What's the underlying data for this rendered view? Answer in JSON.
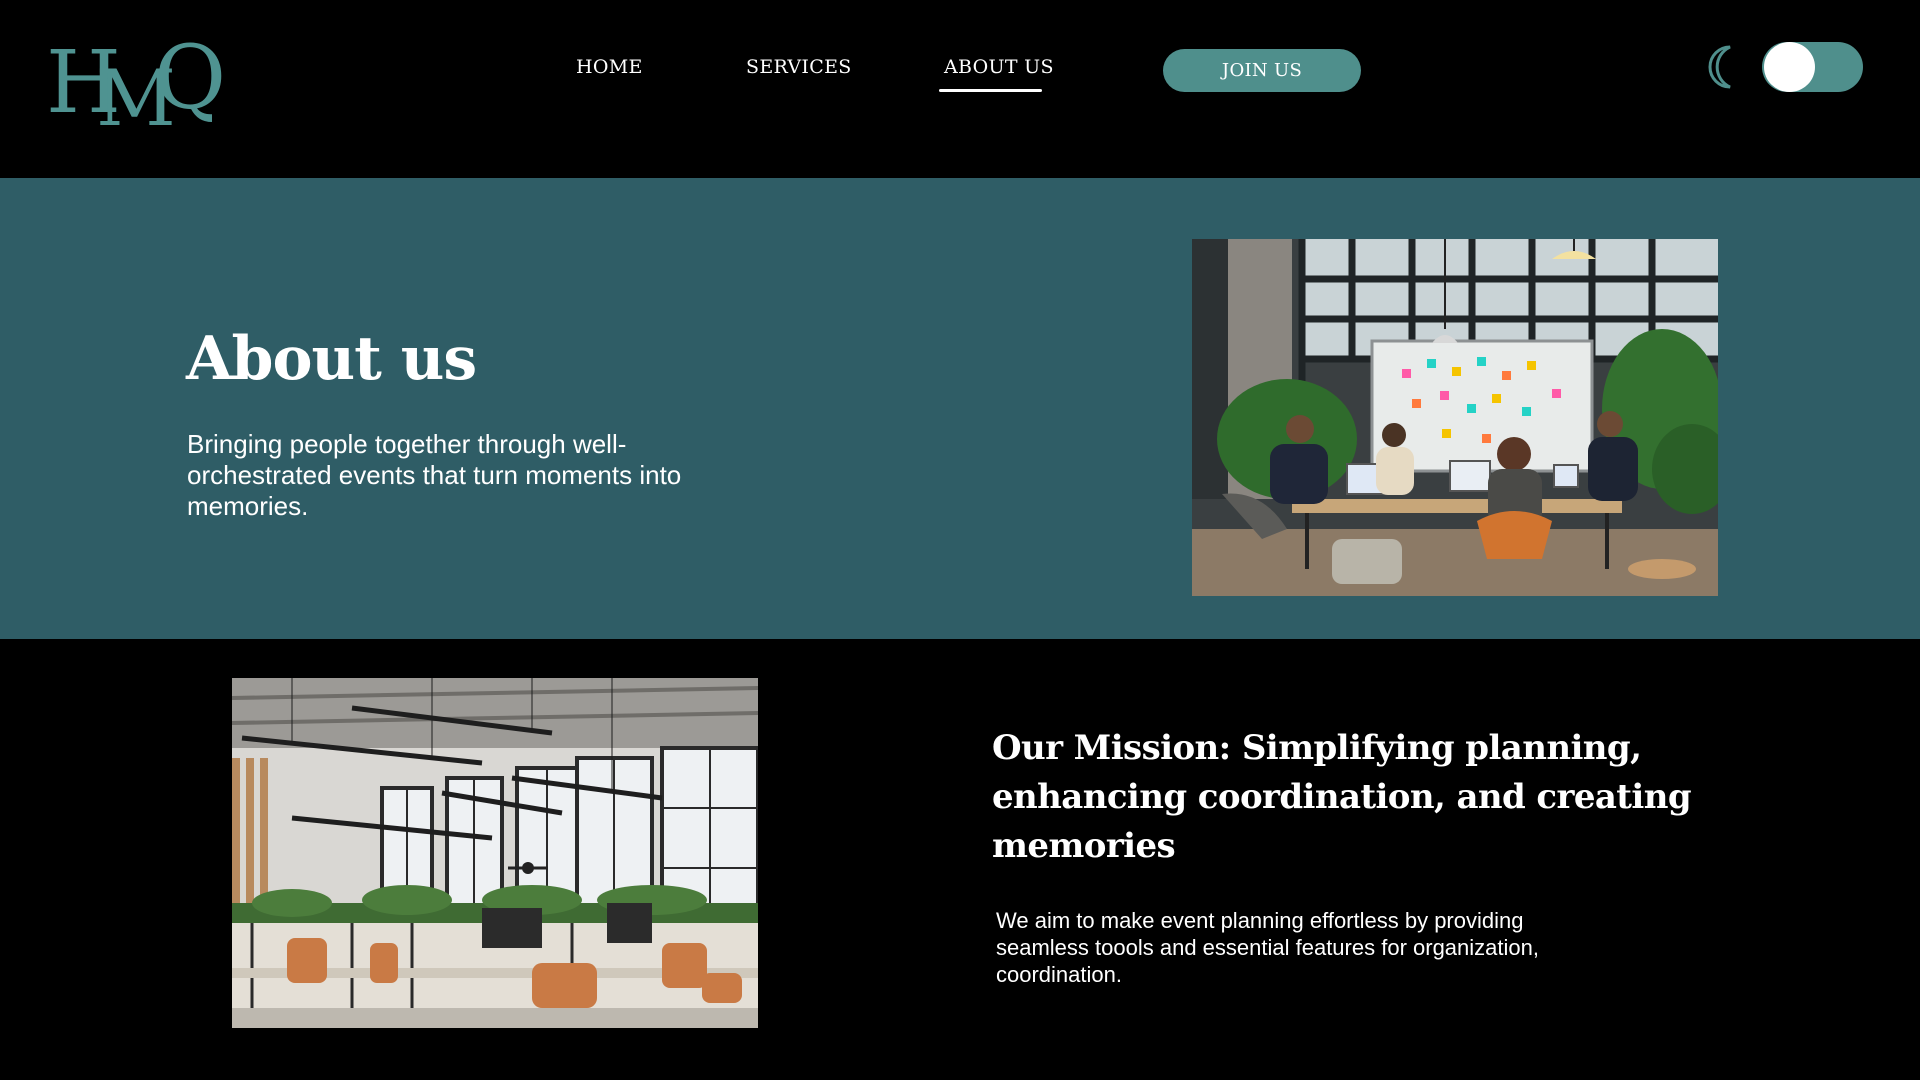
{
  "header": {
    "logo_text": "HMQ",
    "nav": {
      "home": "HOME",
      "services": "SERVICES",
      "about": "ABOUT US",
      "active": "about"
    },
    "join_label": "JOIN US",
    "theme_toggle": {
      "icon": "moon-icon",
      "state": "on"
    }
  },
  "hero": {
    "title": "About us",
    "subtitle": "Bringing people together through well-orchestrated events that turn moments into memories."
  },
  "mission": {
    "title": "Our Mission: Simplifying planning, enhancing coordination, and creating memories",
    "text": "We aim to make event planning effortless by providing seamless toools and essential features for organization, coordination."
  },
  "colors": {
    "accent": "#4f8f8c",
    "hero_background": "#2f5d66",
    "page_background": "#000000",
    "text": "#ffffff"
  }
}
